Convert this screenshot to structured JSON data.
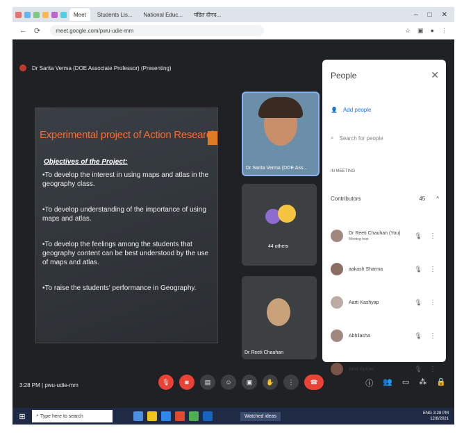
{
  "browser": {
    "tabs": [
      "Meet",
      "Students Lis...",
      "National Educ...",
      "पंडित दीनद..."
    ],
    "url": "meet.google.com/pwu-udie-mm"
  },
  "meeting": {
    "presenter_banner": "Dr Sarita Verma (DOE Associate Professor) (Presenting)",
    "time": "3:28 PM",
    "code": "pwu-udie-mm"
  },
  "slide": {
    "title": "Experimental project of Action Research",
    "subtitle": "Objectives of the Project:",
    "bullets": [
      "•To develop the interest in using maps and atlas in the geography class.",
      "•To develop understanding of the importance of using maps and atlas.",
      "•To develop the feelings among the students that geography content can be best understood by the use of maps and atlas.",
      "•To raise the students' performance in Geography."
    ]
  },
  "tiles": {
    "t1": "Dr Sarita Verma (DOE Ass...",
    "t2": "44 others",
    "t3": "Dr Reeti Chauhan"
  },
  "people": {
    "title": "People",
    "add": "Add people",
    "search": "Search for people",
    "in_meeting": "IN MEETING",
    "contributors": "Contributors",
    "count": "45",
    "list": [
      {
        "name": "Dr Reeti Chauhan (You)",
        "sub": "Meeting host"
      },
      {
        "name": "aakash Sharma",
        "sub": ""
      },
      {
        "name": "Aarti Kashyap",
        "sub": ""
      },
      {
        "name": "Abhilasha",
        "sub": ""
      },
      {
        "name": "Amit Kumar",
        "sub": ""
      }
    ]
  },
  "taskbar": {
    "search": "Type here to search",
    "window": "Watched ideas",
    "time": "3:28 PM",
    "date": "12/6/2021",
    "lang": "ENG"
  },
  "colors": {
    "accent": "#ea4335",
    "title_orange": "#ff6a2a"
  }
}
